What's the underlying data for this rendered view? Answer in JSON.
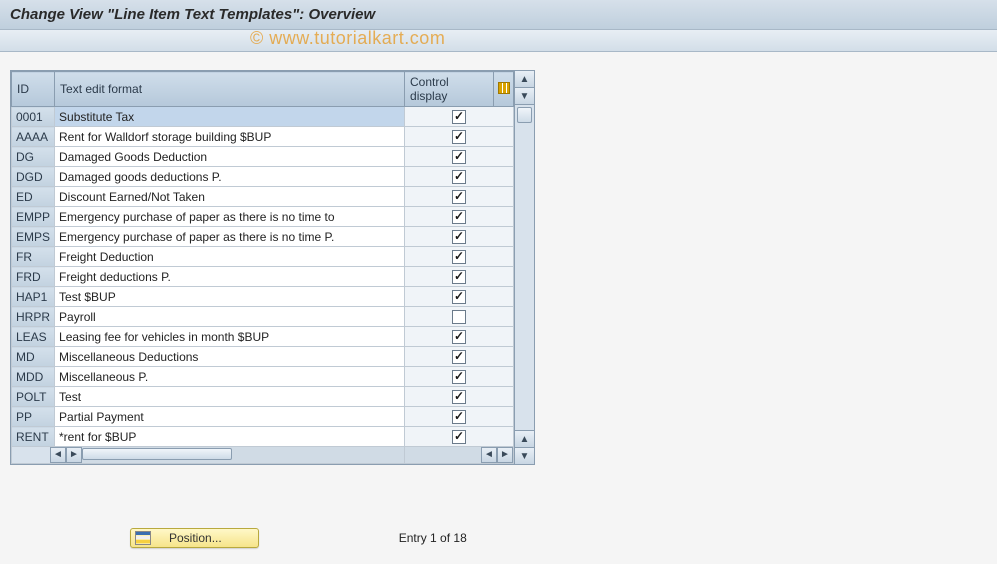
{
  "title": "Change View \"Line Item Text Templates\": Overview",
  "watermark": "© www.tutorialkart.com",
  "columns": {
    "id": "ID",
    "text": "Text edit format",
    "control": "Control display"
  },
  "rows": [
    {
      "id": "0001",
      "text": "Substitute Tax",
      "checked": true,
      "selected": true
    },
    {
      "id": "AAAA",
      "text": "Rent for Walldorf storage building $BUP",
      "checked": true
    },
    {
      "id": "DG",
      "text": "Damaged Goods Deduction",
      "checked": true
    },
    {
      "id": "DGD",
      "text": "Damaged goods deductions P.",
      "checked": true
    },
    {
      "id": "ED",
      "text": "Discount Earned/Not Taken",
      "checked": true
    },
    {
      "id": "EMPP",
      "text": "Emergency purchase of paper as there is no time to",
      "checked": true
    },
    {
      "id": "EMPS",
      "text": "Emergency purchase of paper as there is no time P.",
      "checked": true
    },
    {
      "id": "FR",
      "text": "Freight Deduction",
      "checked": true
    },
    {
      "id": "FRD",
      "text": "Freight deductions P.",
      "checked": true
    },
    {
      "id": "HAP1",
      "text": "Test $BUP",
      "checked": true
    },
    {
      "id": "HRPR",
      "text": "Payroll",
      "checked": false
    },
    {
      "id": "LEAS",
      "text": "Leasing fee for vehicles in month $BUP",
      "checked": true
    },
    {
      "id": "MD",
      "text": "Miscellaneous Deductions",
      "checked": true
    },
    {
      "id": "MDD",
      "text": "Miscellaneous P.",
      "checked": true
    },
    {
      "id": "POLT",
      "text": "Test",
      "checked": true
    },
    {
      "id": "PP",
      "text": "Partial Payment",
      "checked": true
    },
    {
      "id": "RENT",
      "text": "*rent for $BUP",
      "checked": true
    }
  ],
  "footer": {
    "position_label": "Position...",
    "entry_status": "Entry 1 of 18"
  }
}
